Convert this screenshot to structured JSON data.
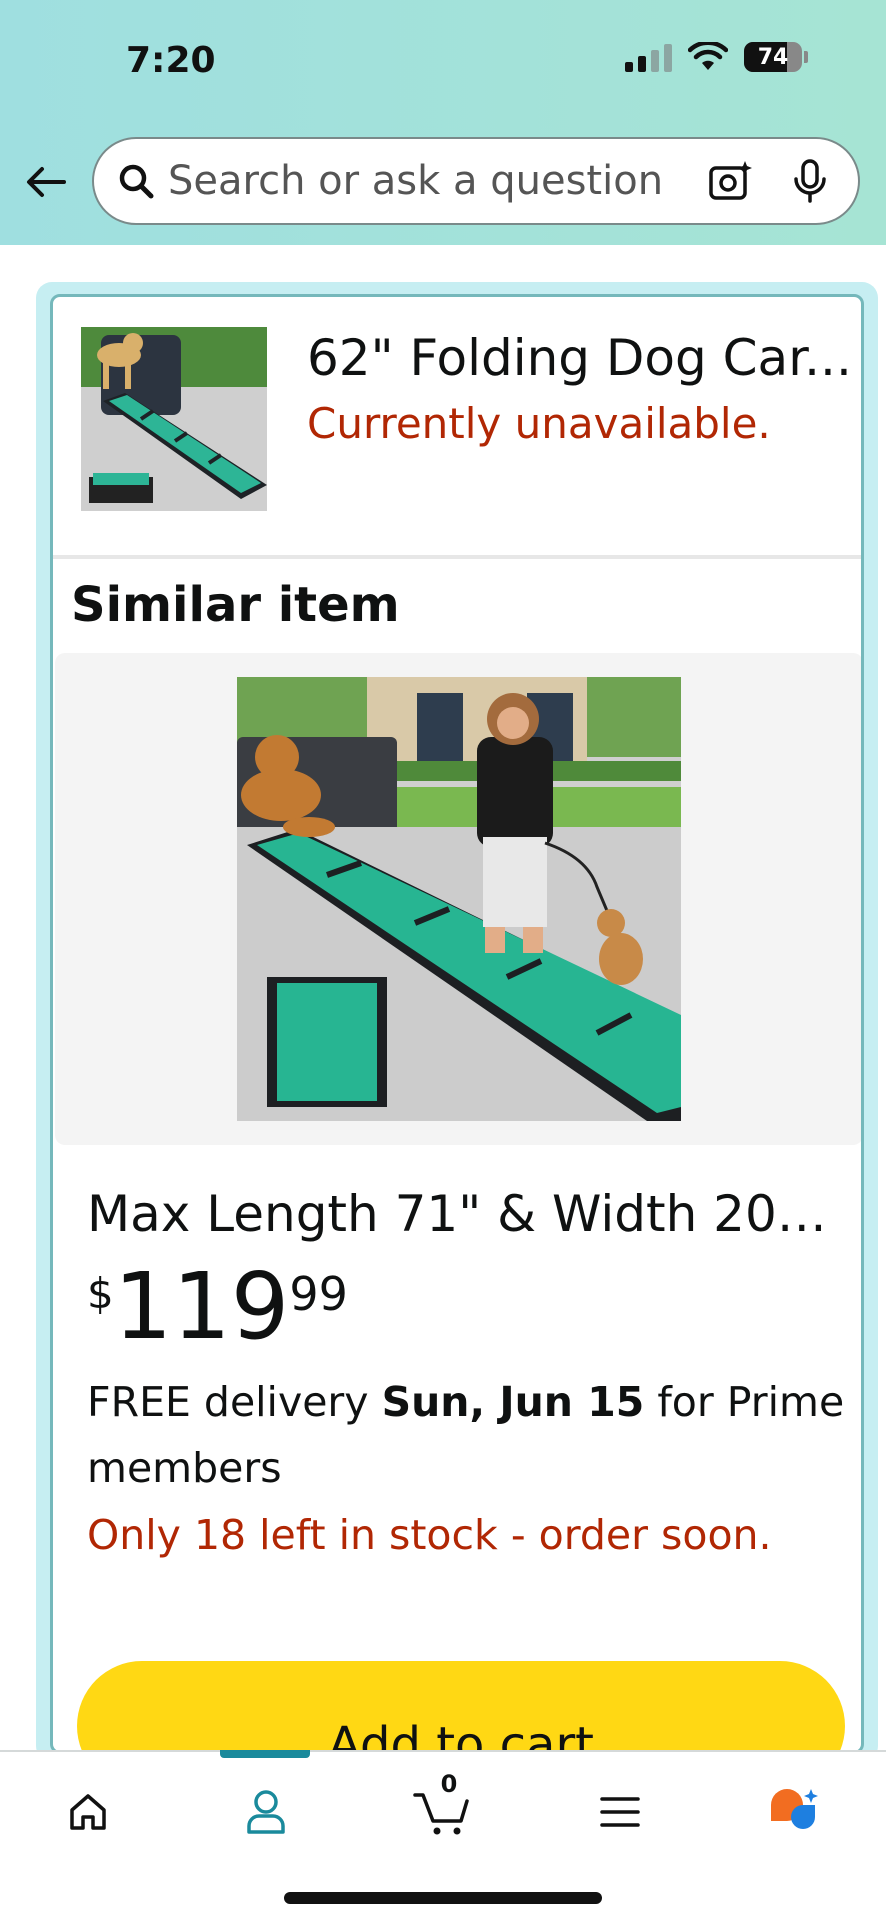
{
  "status_bar": {
    "time": "7:20",
    "battery": "74"
  },
  "search": {
    "placeholder": "Search or ask a question"
  },
  "product": {
    "title": "62\" Folding Dog Car...",
    "status": "Currently unavailable."
  },
  "similar": {
    "heading": "Similar item",
    "title": "Max Length 71\" & Width 20\"...",
    "price": {
      "currency": "$",
      "whole": "119",
      "fraction": "99"
    },
    "delivery_prefix": "FREE delivery ",
    "delivery_date": "Sun, Jun 15",
    "delivery_suffix": " for Prime members",
    "stock": "Only 18 left in stock - order soon.",
    "add_to_cart": "Add to cart"
  },
  "tabs": [
    {
      "icon": "home-icon"
    },
    {
      "icon": "profile-icon",
      "active": true
    },
    {
      "icon": "cart-icon",
      "count": "0"
    },
    {
      "icon": "menu-icon"
    },
    {
      "icon": "rufus-assistant-icon"
    }
  ],
  "colors": {
    "accent": "#1a8a9c",
    "button": "#ffd814",
    "alert": "#b12704"
  }
}
